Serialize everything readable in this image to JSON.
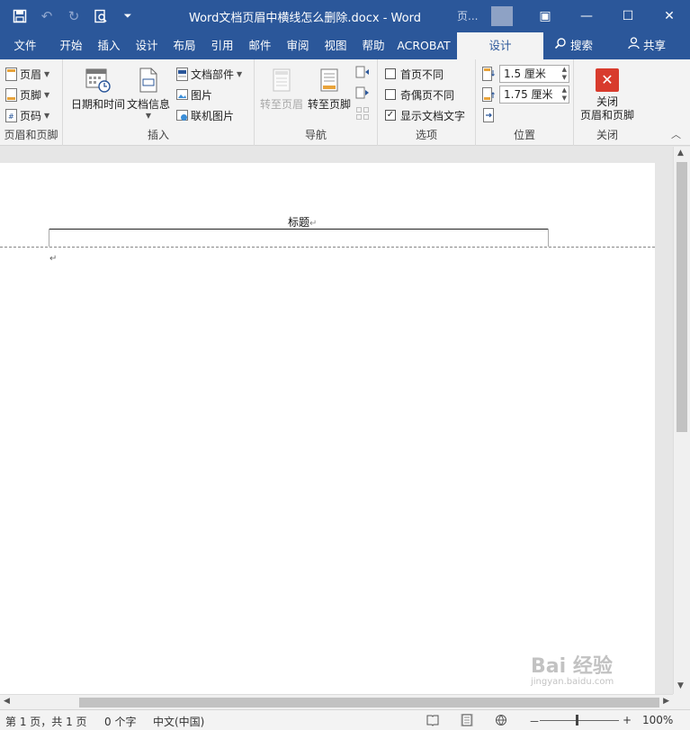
{
  "titlebar": {
    "title": "Word文档页眉中横线怎么删除.docx  -  Word",
    "extra": "页...",
    "qat": {
      "save": "save-icon",
      "undo": "undo-icon",
      "redo": "redo-icon",
      "preview": "print-preview-icon",
      "customize": "customize-icon"
    },
    "controls": {
      "ribbon_opts": "▣",
      "minimize": "—",
      "maximize": "☐",
      "close": "✕"
    }
  },
  "tabs": [
    {
      "label": "文件"
    },
    {
      "label": "开始"
    },
    {
      "label": "插入"
    },
    {
      "label": "设计"
    },
    {
      "label": "布局"
    },
    {
      "label": "引用"
    },
    {
      "label": "邮件"
    },
    {
      "label": "审阅"
    },
    {
      "label": "视图"
    },
    {
      "label": "帮助"
    },
    {
      "label": "ACROBAT"
    },
    {
      "label": "设计"
    }
  ],
  "tab_right": {
    "search": "搜索",
    "share": "共享"
  },
  "ribbon": {
    "header_footer": {
      "label": "页眉和页脚",
      "header": "页眉",
      "footer": "页脚",
      "page_number": "页码"
    },
    "insert": {
      "label": "插入",
      "datetime": "日期和时间",
      "docinfo": "文档信息",
      "quickparts": "文档部件",
      "picture": "图片",
      "online_picture": "联机图片"
    },
    "navigation": {
      "label": "导航",
      "goto_header": "转至页眉",
      "goto_footer": "转至页脚"
    },
    "options": {
      "label": "选项",
      "different_first": "首页不同",
      "different_odd_even": "奇偶页不同",
      "show_doc_text": "显示文档文字",
      "different_first_checked": false,
      "different_odd_even_checked": false,
      "show_doc_text_checked": true
    },
    "position": {
      "label": "位置",
      "header_from_top": "1.5 厘米",
      "footer_from_bottom": "1.75 厘米"
    },
    "close": {
      "label": "关闭",
      "button_line1": "关闭",
      "button_line2": "页眉和页脚"
    }
  },
  "document": {
    "header_text": "标题",
    "para_mark": "↵"
  },
  "statusbar": {
    "page": "第 1 页，共 1 页",
    "words": "0 个字",
    "language": "中文(中国)",
    "zoom": "100%"
  },
  "watermark": {
    "text": "Bai 经验",
    "sub": "jingyan.baidu.com"
  }
}
